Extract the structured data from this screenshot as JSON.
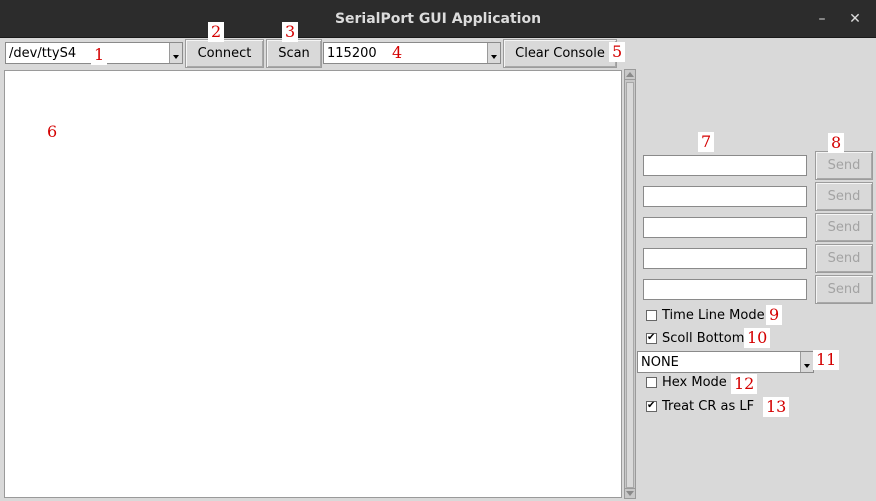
{
  "window": {
    "title": "SerialPort GUI Application",
    "minimize_glyph": "–",
    "close_glyph": "✕"
  },
  "toolbar": {
    "port_value": "/dev/ttyS4",
    "connect_label": "Connect",
    "scan_label": "Scan",
    "baud_value": "115200",
    "clear_label": "Clear Console"
  },
  "send_panel": {
    "send_label": "Send",
    "rows": [
      {
        "value": "",
        "send_label": "Send"
      },
      {
        "value": "",
        "send_label": "Send"
      },
      {
        "value": "",
        "send_label": "Send"
      },
      {
        "value": "",
        "send_label": "Send"
      },
      {
        "value": "",
        "send_label": "Send"
      }
    ]
  },
  "options": {
    "time_line_mode": {
      "label": "Time Line Mode",
      "checked": false
    },
    "scroll_bottom": {
      "label": "Scoll Bottom",
      "checked": true
    },
    "line_ending_value": "NONE",
    "hex_mode": {
      "label": "Hex Mode",
      "checked": false
    },
    "treat_cr_as_lf": {
      "label": "Treat CR as LF",
      "checked": true
    }
  },
  "annotations": [
    "1",
    "2",
    "3",
    "4",
    "5",
    "6",
    "7",
    "8",
    "9",
    "10",
    "11",
    "12",
    "13"
  ],
  "colors": {
    "titlebar_bg": "#2c2c2c",
    "window_bg": "#d9d9d9",
    "annotation_text": "#d40000"
  }
}
